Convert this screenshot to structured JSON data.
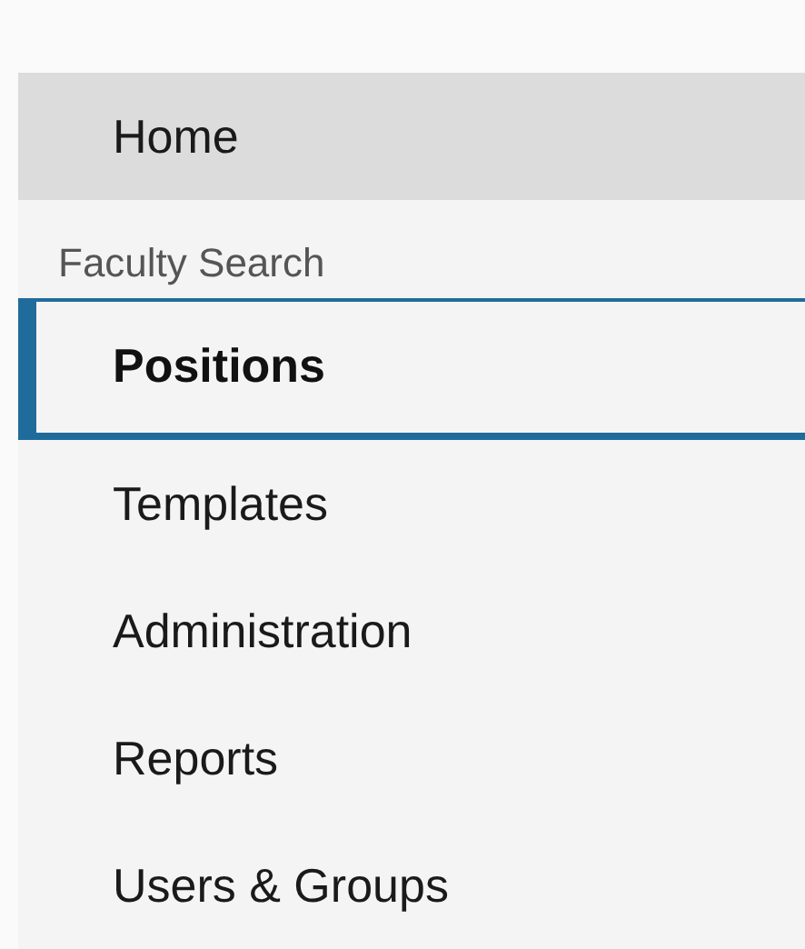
{
  "home": {
    "label": "Home"
  },
  "section": {
    "title": "Faculty Search",
    "items": [
      {
        "label": "Positions",
        "selected": true
      },
      {
        "label": "Templates",
        "selected": false
      },
      {
        "label": "Administration",
        "selected": false
      },
      {
        "label": "Reports",
        "selected": false
      },
      {
        "label": "Users & Groups",
        "selected": false
      }
    ]
  }
}
